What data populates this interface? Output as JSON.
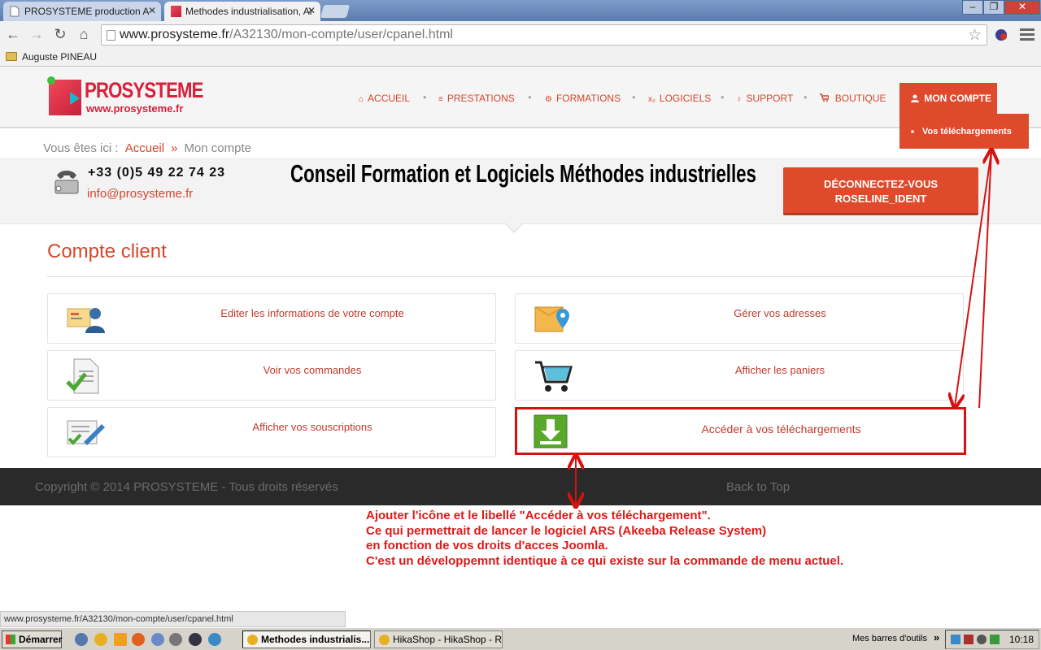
{
  "browser": {
    "tabs": [
      {
        "label": "PROSYSTEME production A",
        "active": false
      },
      {
        "label": "Methodes industrialisation, Ar",
        "active": true
      }
    ],
    "url_host": "www.prosysteme.fr",
    "url_path": "/A32130/mon-compte/user/cpanel.html",
    "bookmark": "Auguste PINEAU",
    "status_url": "www.prosysteme.fr/A32130/mon-compte/user/cpanel.html"
  },
  "site": {
    "logo_brand": "PROSYSTEME",
    "logo_url": "www.prosysteme.fr",
    "nav": [
      {
        "label": "ACCUEIL",
        "icon": "home-icon",
        "glyph": "⌂"
      },
      {
        "label": "PRESTATIONS",
        "icon": "list-icon",
        "glyph": "≡"
      },
      {
        "label": "FORMATIONS",
        "icon": "cogs-icon",
        "glyph": "⚙"
      },
      {
        "label": "LOGICIELS",
        "icon": "subscript-icon",
        "glyph": "x₂"
      },
      {
        "label": "SUPPORT",
        "icon": "lightbulb-icon",
        "glyph": "♀"
      },
      {
        "label": "BOUTIQUE",
        "icon": "cart-icon",
        "glyph": "🛒"
      }
    ],
    "account_label": "MON COMPTE",
    "account_dropdown_item": "Vos téléchargements",
    "breadcrumb_prefix": "Vous êtes ici :",
    "breadcrumb_home": "Accueil",
    "breadcrumb_sep": "»",
    "breadcrumb_current": "Mon compte",
    "phone": "+33 (0)5 49 22 74 23",
    "email": "info@prosysteme.fr",
    "tagline": "Conseil Formation et Logiciels Méthodes industrielles",
    "logout_line1": "DÉCONNECTEZ-VOUS",
    "logout_line2": "ROSELINE_IDENT",
    "section_title": "Compte client",
    "cards": [
      {
        "label": "Editer les informations de votre compte",
        "icon": "user-card-icon"
      },
      {
        "label": "Gérer vos adresses",
        "icon": "address-map-pin-icon"
      },
      {
        "label": "Voir vos commandes",
        "icon": "orders-check-icon"
      },
      {
        "label": "Afficher les paniers",
        "icon": "shopping-cart-icon"
      },
      {
        "label": "Afficher vos souscriptions",
        "icon": "subscription-pen-icon"
      },
      {
        "label": "Accéder à vos téléchargements",
        "icon": "download-icon"
      }
    ],
    "copyright": "Copyright © 2014 PROSYSTEME - Tous droits réservés",
    "back_to_top": "Back to Top"
  },
  "annotation": {
    "lines": [
      "Ajouter l'icône et le libellé \"Accéder à vos téléchargement\".",
      "Ce qui permettrait de lancer le logiciel ARS (Akeeba Release System)",
      "en fonction de vos droits d'acces Joomla.",
      "C'est un développemnt identique à ce qui existe sur la commande de menu actuel."
    ],
    "color": "#e01818"
  },
  "taskbar": {
    "start_label": "Démarrer",
    "tasks": [
      {
        "label": "Methodes industrialis...",
        "active": true
      },
      {
        "label": "HikaShop - HikaShop - R...",
        "active": false
      }
    ],
    "toolbars_label": "Mes barres d'outils",
    "clock": "10:18"
  },
  "colors": {
    "accent": "#e04a2c",
    "link": "#d4462a",
    "footer_bg": "#2a2a2a"
  }
}
